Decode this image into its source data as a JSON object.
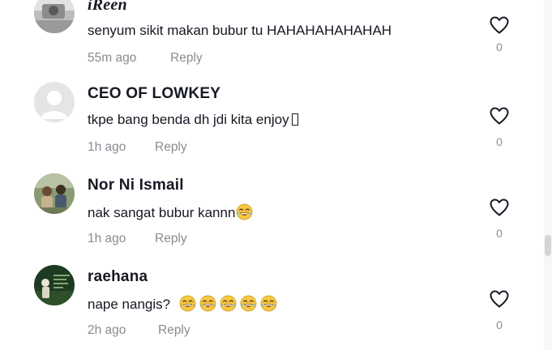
{
  "comments": [
    {
      "username": "iReen",
      "text": "senyum sikit makan bubur tu HAHAHAHAHAHAH",
      "time": "55m ago",
      "reply_label": "Reply",
      "likes": "0"
    },
    {
      "username": "CEO OF LOWKEY",
      "text": "tkpe bang benda dh jdi kita enjoy",
      "time": "1h ago",
      "reply_label": "Reply",
      "likes": "0"
    },
    {
      "username": "Nor Ni Ismail",
      "text": "nak sangat bubur kannn",
      "time": "1h ago",
      "reply_label": "Reply",
      "likes": "0"
    },
    {
      "username": "raehana",
      "text": "nape nangis?",
      "time": "2h ago",
      "reply_label": "Reply",
      "likes": "0"
    }
  ],
  "icons": {
    "like": "heart-outline-icon",
    "emoji": "tears-of-joy-emoji"
  },
  "colors": {
    "text": "#161823",
    "muted": "#8a8b91",
    "emoji_face": "#f7c843"
  }
}
